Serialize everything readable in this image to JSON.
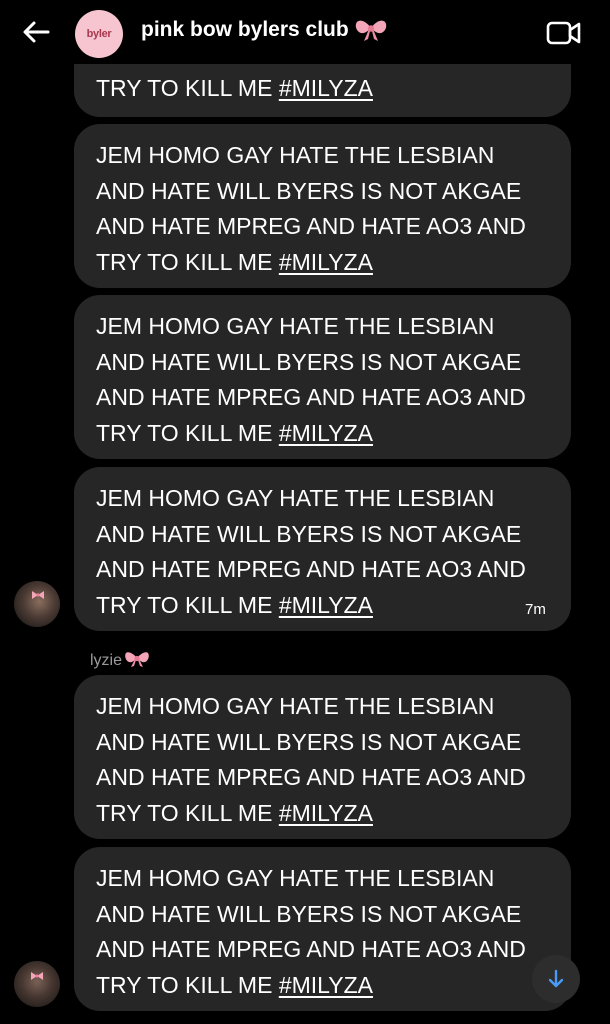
{
  "header": {
    "title": "pink bow bylers club",
    "group_avatar_text": "byler",
    "back_icon": "arrow-left-icon",
    "video_icon": "video-camera-icon",
    "bow_icon": "pink-bow-icon"
  },
  "colors": {
    "background": "#000000",
    "bubble": "#262626",
    "text": "#ffffff",
    "muted": "#9a9a9a",
    "accent_blue": "#4a9bf5",
    "bow_pink": "#f4a6b8"
  },
  "messages": [
    {
      "lines": [
        "TRY TO KILL ME "
      ],
      "hashtag": "#MILYZA"
    },
    {
      "lines": [
        "JEM HOMO GAY HATE THE LESBIAN",
        "AND HATE WILL BYERS IS NOT AKGAE",
        "AND HATE MPREG AND HATE AO3 AND",
        "TRY TO KILL ME "
      ],
      "hashtag": "#MILYZA"
    },
    {
      "lines": [
        "JEM HOMO GAY HATE THE LESBIAN",
        "AND HATE WILL BYERS IS NOT AKGAE",
        "AND HATE MPREG AND HATE AO3 AND",
        "TRY TO KILL ME "
      ],
      "hashtag": "#MILYZA"
    },
    {
      "lines": [
        "JEM HOMO GAY HATE THE LESBIAN",
        "AND HATE WILL BYERS IS NOT AKGAE",
        "AND HATE MPREG AND HATE AO3 AND",
        "TRY TO KILL ME "
      ],
      "hashtag": "#MILYZA",
      "time": "7m"
    },
    {
      "lines": [
        "JEM HOMO GAY HATE THE LESBIAN",
        "AND HATE WILL BYERS IS NOT AKGAE",
        "AND HATE MPREG AND HATE AO3 AND",
        "TRY TO KILL ME "
      ],
      "hashtag": "#MILYZA"
    },
    {
      "lines": [
        "JEM HOMO GAY HATE THE LESBIAN",
        "AND HATE WILL BYERS IS NOT AKGAE",
        "AND HATE MPREG AND HATE AO3 AND",
        "TRY TO KILL ME "
      ],
      "hashtag": "#MILYZA"
    }
  ],
  "sender_name": "lyzie",
  "scroll_button_icon": "arrow-down-icon"
}
